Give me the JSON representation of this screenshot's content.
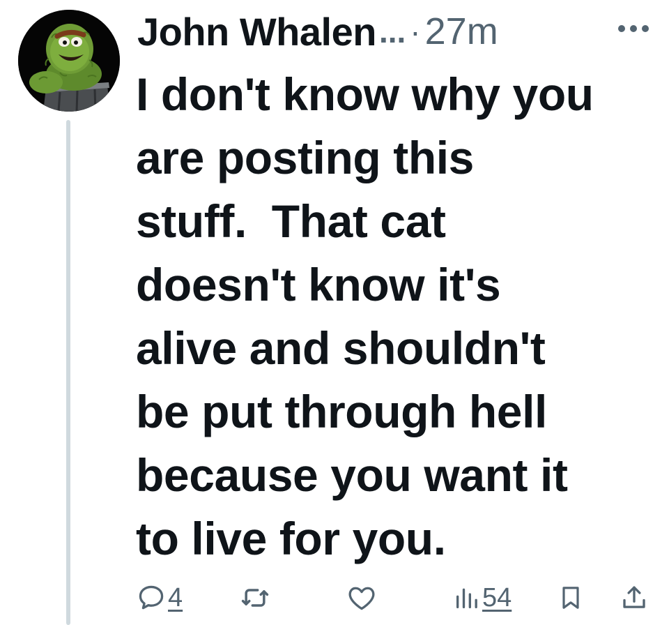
{
  "post": {
    "author_name": "John Whalen",
    "name_truncation": "...",
    "separator": "·",
    "time_ago": "27m",
    "text": "I don't know why you\nare posting this\nstuff.  That cat\ndoesn't know it's\nalive and shouldn't\nbe put through hell\nbecause you want it\nto live for you.",
    "avatar_icon": "green-furry-puppet-in-trash-can-avatar"
  },
  "actions": {
    "reply_count": "4",
    "views_count": "54",
    "icons": {
      "reply": "speech-bubble-icon",
      "repost": "repost-arrows-icon",
      "like": "heart-icon",
      "views": "bar-chart-icon",
      "bookmark": "bookmark-icon",
      "share": "share-upload-icon",
      "more": "more-dots-icon"
    }
  },
  "colors": {
    "text": "#0f1419",
    "secondary": "#536471",
    "thread_line": "#cfd9de",
    "background": "#ffffff"
  }
}
